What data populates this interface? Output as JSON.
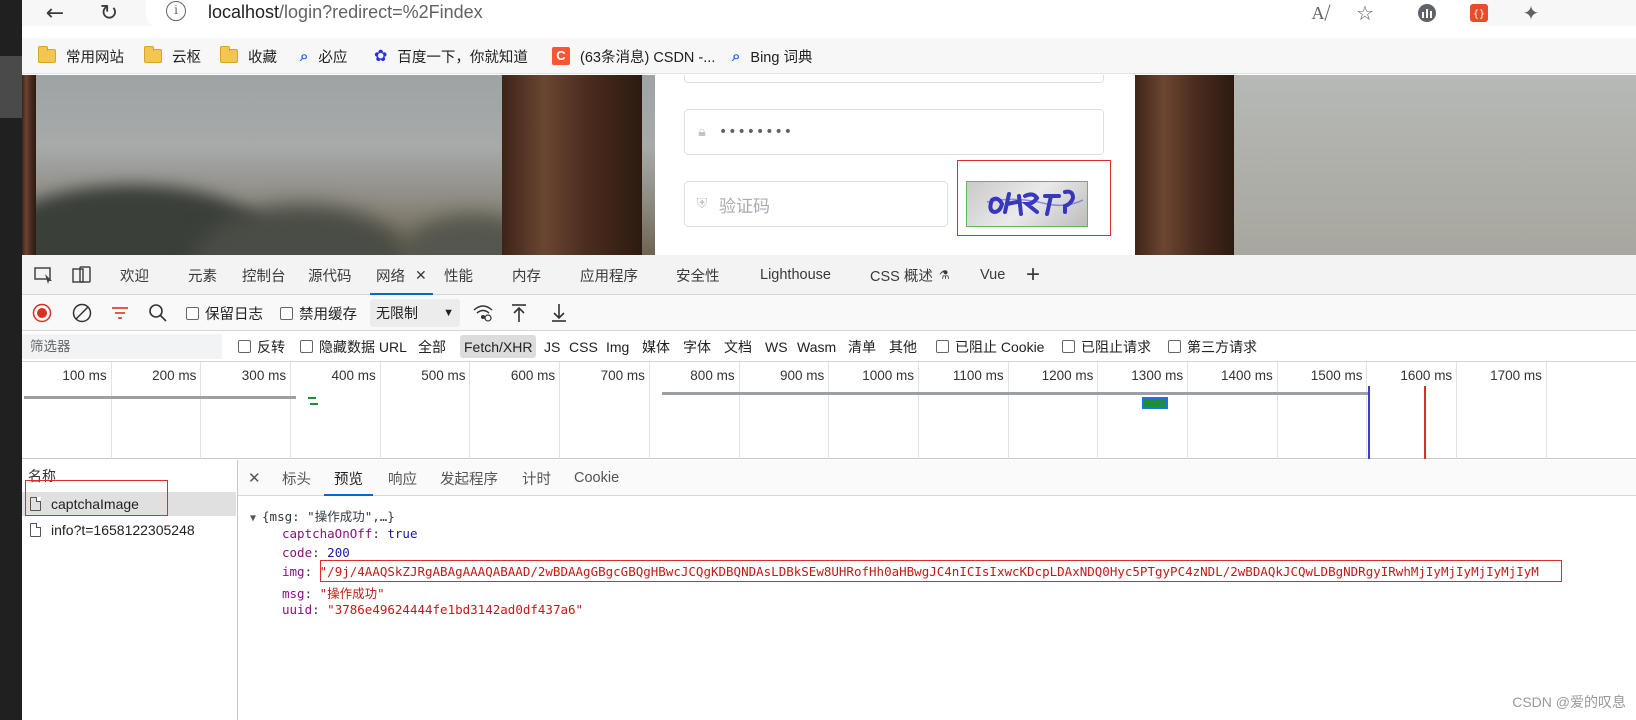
{
  "browser": {
    "url_host": "localhost",
    "url_path": "/login?redirect=%2Findex",
    "bookmarks": [
      {
        "label": "常用网站",
        "icon": "folder-icon"
      },
      {
        "label": "云枢",
        "icon": "folder-icon"
      },
      {
        "label": "收藏",
        "icon": "folder-icon"
      },
      {
        "label": "必应",
        "icon": "search-icon"
      },
      {
        "label": "百度一下，你就知道",
        "icon": "baidu-paw-icon"
      },
      {
        "label": "(63条消息) CSDN -...",
        "icon": "csdn-icon"
      },
      {
        "label": "Bing 词典",
        "icon": "search-icon"
      }
    ]
  },
  "login": {
    "password_value": "••••••••",
    "captcha_placeholder": "验证码"
  },
  "devtools": {
    "tabs": [
      "欢迎",
      "元素",
      "控制台",
      "源代码",
      "网络",
      "性能",
      "内存",
      "应用程序",
      "安全性",
      "Lighthouse",
      "CSS 概述",
      "Vue"
    ],
    "active_tab": "网络",
    "toolbar": {
      "preserve_log": "保留日志",
      "disable_cache": "禁用缓存",
      "throttle": "无限制"
    },
    "filter": {
      "placeholder": "筛选器",
      "invert": "反转",
      "hide_data_urls": "隐藏数据 URL",
      "types": [
        "全部",
        "Fetch/XHR",
        "JS",
        "CSS",
        "Img",
        "媒体",
        "字体",
        "文档",
        "WS",
        "Wasm",
        "清单",
        "其他"
      ],
      "selected_type": "Fetch/XHR",
      "blocked_cookies": "已阻止 Cookie",
      "blocked_requests": "已阻止请求",
      "third_party": "第三方请求"
    },
    "timeline_ticks": [
      "100 ms",
      "200 ms",
      "300 ms",
      "400 ms",
      "500 ms",
      "600 ms",
      "700 ms",
      "800 ms",
      "900 ms",
      "1000 ms",
      "1100 ms",
      "1200 ms",
      "1300 ms",
      "1400 ms",
      "1500 ms",
      "1600 ms",
      "1700 ms"
    ],
    "requests_header": "名称",
    "requests": [
      "captchaImage",
      "info?t=1658122305248"
    ],
    "detail_tabs": [
      "标头",
      "预览",
      "响应",
      "发起程序",
      "计时",
      "Cookie"
    ],
    "active_detail_tab": "预览",
    "preview": {
      "summary": "{msg: \"操作成功\",…}",
      "fields": [
        {
          "key": "captchaOnOff",
          "value": "true",
          "type": "bool"
        },
        {
          "key": "code",
          "value": "200",
          "type": "number"
        },
        {
          "key": "img",
          "value": "\"/9j/4AAQSkZJRgABAgAAAQABAAD/2wBDAAgGBgcGBQgHBwcJCQgKDBQNDAsLDBkSEw8UHRofHh0aHBwgJC4nICIsIxwcKDcpLDAxNDQ0Hyc5PTgyPC4zNDL/2wBDAQkJCQwLDBgNDRgyIRwhMjIyMjIyMjIyMjIyM",
          "type": "string"
        },
        {
          "key": "msg",
          "value": "\"操作成功\"",
          "type": "string"
        },
        {
          "key": "uuid",
          "value": "\"3786e49624444fe1bd3142ad0df437a6\"",
          "type": "string"
        }
      ]
    }
  },
  "watermark": "CSDN @爱的叹息",
  "colors": {
    "accent": "#0a64d4",
    "highlight_box": "#e02b2b",
    "json_key": "#881280",
    "json_string": "#c41a16",
    "json_number": "#1a1aa6"
  }
}
